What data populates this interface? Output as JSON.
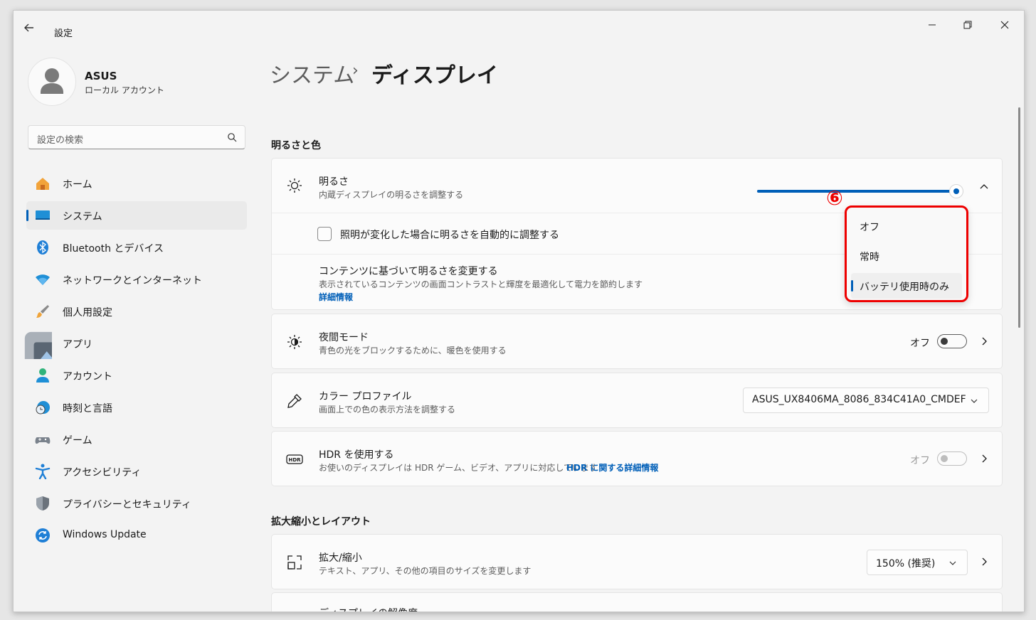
{
  "window": {
    "title": "設定"
  },
  "user": {
    "name": "ASUS",
    "account_type": "ローカル アカウント"
  },
  "search": {
    "placeholder": "設定の検索"
  },
  "sidebar": {
    "items": [
      {
        "label": "ホーム"
      },
      {
        "label": "システム"
      },
      {
        "label": "Bluetooth とデバイス"
      },
      {
        "label": "ネットワークとインターネット"
      },
      {
        "label": "個人用設定"
      },
      {
        "label": "アプリ"
      },
      {
        "label": "アカウント"
      },
      {
        "label": "時刻と言語"
      },
      {
        "label": "ゲーム"
      },
      {
        "label": "アクセシビリティ"
      },
      {
        "label": "プライバシーとセキュリティ"
      },
      {
        "label": "Windows Update"
      }
    ],
    "selected": "システム"
  },
  "header": {
    "parent": "システム",
    "separator": "›",
    "current": "ディスプレイ"
  },
  "sections": {
    "brightness_color": "明るさと色",
    "scale_layout": "拡大縮小とレイアウト"
  },
  "brightness": {
    "title": "明るさ",
    "desc": "内蔵ディスプレイの明るさを調整する",
    "level": 1.0,
    "auto_adjust_label": "照明が変化した場合に明るさを自動的に調整する",
    "auto_adjust_checked": false,
    "content_title": "コンテンツに基づいて明るさを変更する",
    "content_desc": "表示されているコンテンツの画面コントラストと輝度を最適化して電力を節約します",
    "content_link": "詳細情報"
  },
  "flyout": {
    "options": [
      "オフ",
      "常時",
      "バッテリ使用時のみ"
    ],
    "selected": "バッテリ使用時のみ"
  },
  "annotation": {
    "marker": "⑥",
    "color": "#e00000"
  },
  "night_light": {
    "title": "夜間モード",
    "desc": "青色の光をブロックするために、暖色を使用する",
    "state": "オフ"
  },
  "color_profile": {
    "title": "カラー プロファイル",
    "desc": "画面上での色の表示方法を調整する",
    "value": "ASUS_UX8406MA_8086_834C41A0_CMDEF"
  },
  "hdr": {
    "title": "HDR を使用する",
    "desc": "お使いのディスプレイは HDR ゲーム、ビデオ、アプリに対応しています",
    "link": "HDR に関する詳細情報",
    "state": "オフ"
  },
  "scale": {
    "title": "拡大/縮小",
    "desc": "テキスト、アプリ、その他の項目のサイズを変更します",
    "value": "150% (推奨)"
  },
  "resolution": {
    "title": "ディスプレイの解像度"
  },
  "colors": {
    "accent": "#005fb8",
    "highlight": "#e00000"
  }
}
